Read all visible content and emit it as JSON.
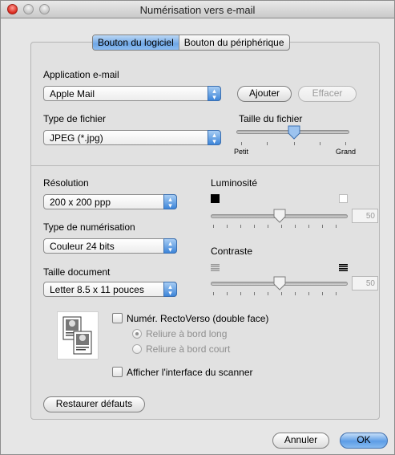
{
  "window": {
    "title": "Numérisation vers e-mail"
  },
  "tabs": [
    {
      "label": "Bouton du logiciel",
      "active": true
    },
    {
      "label": "Bouton du périphérique",
      "active": false
    }
  ],
  "email_app": {
    "label": "Application e-mail",
    "selected": "Apple Mail",
    "add_button": "Ajouter",
    "remove_button": "Effacer"
  },
  "file_type": {
    "label": "Type de fichier",
    "selected": "JPEG (*.jpg)"
  },
  "file_size": {
    "label": "Taille du fichier",
    "min_label": "Petit",
    "max_label": "Grand",
    "level": 0.4
  },
  "resolution": {
    "label": "Résolution",
    "selected": "200 x 200 ppp"
  },
  "scan_type": {
    "label": "Type de numérisation",
    "selected": "Couleur 24 bits"
  },
  "doc_size": {
    "label": "Taille document",
    "selected": "Letter  8.5 x 11 pouces"
  },
  "brightness": {
    "label": "Luminosité",
    "value": "50"
  },
  "contrast": {
    "label": "Contraste",
    "value": "50"
  },
  "duplex": {
    "label": "Numér. RectoVerso (double face)",
    "checked": false,
    "options": [
      "Reliure à bord long",
      "Reliure à bord court"
    ],
    "selected": "Reliure à bord long"
  },
  "show_scanner_ui": {
    "label": "Afficher l'interface du scanner",
    "checked": false
  },
  "footer": {
    "restore_button": "Restaurer défauts",
    "cancel_button": "Annuler",
    "ok_button": "OK"
  },
  "colors": {
    "accent": "#5d9de6",
    "close": "#d9281d"
  },
  "icons": {
    "popup_arrows": "up-down-chevron-icon",
    "brightness_dark": "black-square-icon",
    "brightness_light": "white-square-icon",
    "contrast_low": "low-contrast-icon",
    "contrast_high": "high-contrast-icon",
    "duplex_doc": "duplex-document-icon"
  }
}
